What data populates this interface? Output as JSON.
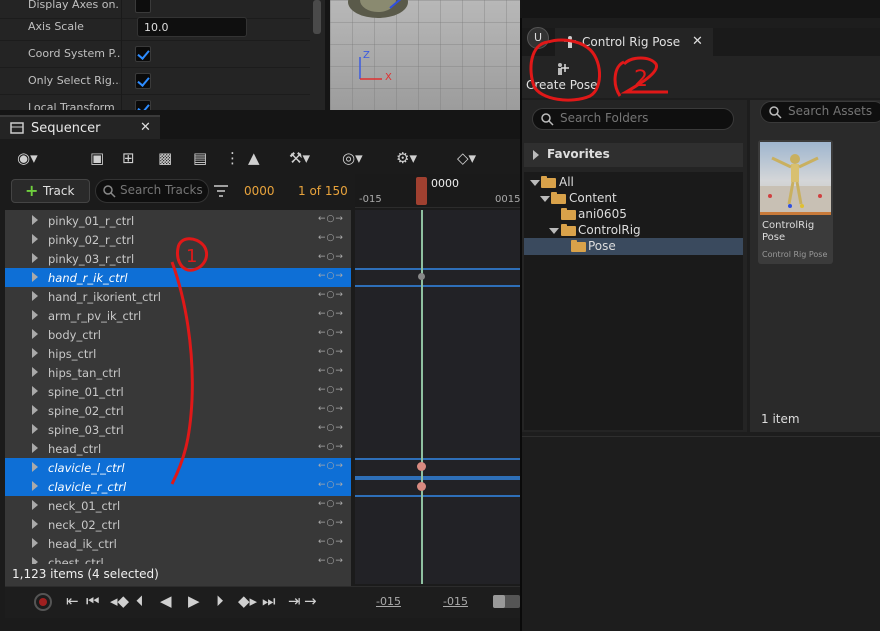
{
  "details": {
    "rows": [
      {
        "label": "Display Axes on...",
        "type": "checkbox",
        "checked": false
      },
      {
        "label": "Axis Scale",
        "type": "number",
        "value": "10.0"
      },
      {
        "label": "Coord System P...",
        "type": "checkbox",
        "checked": true
      },
      {
        "label": "Only Select Rig...",
        "type": "checkbox",
        "checked": true
      },
      {
        "label": "Local Transform",
        "type": "checkbox",
        "checked": true
      }
    ]
  },
  "viewport": {
    "axis_z": "Z",
    "axis_x": "X"
  },
  "sequencer": {
    "tab_title": "Sequencer",
    "add_track_label": "Track",
    "search_placeholder": "Search Tracks",
    "current_frame": "0000",
    "frame_of": "1 of 150",
    "ruler_playhead": "0000",
    "ruler_left": "-015",
    "ruler_right": "0015",
    "tracks": [
      {
        "name": "pinky_01_r_ctrl",
        "selected": false
      },
      {
        "name": "pinky_02_r_ctrl",
        "selected": false
      },
      {
        "name": "pinky_03_r_ctrl",
        "selected": false
      },
      {
        "name": "hand_r_ik_ctrl",
        "selected": true
      },
      {
        "name": "hand_r_ikorient_ctrl",
        "selected": false
      },
      {
        "name": "arm_r_pv_ik_ctrl",
        "selected": false
      },
      {
        "name": "body_ctrl",
        "selected": false
      },
      {
        "name": "hips_ctrl",
        "selected": false
      },
      {
        "name": "hips_tan_ctrl",
        "selected": false
      },
      {
        "name": "spine_01_ctrl",
        "selected": false
      },
      {
        "name": "spine_02_ctrl",
        "selected": false
      },
      {
        "name": "spine_03_ctrl",
        "selected": false
      },
      {
        "name": "head_ctrl",
        "selected": false
      },
      {
        "name": "clavicle_l_ctrl",
        "selected": true
      },
      {
        "name": "clavicle_r_ctrl",
        "selected": true
      },
      {
        "name": "neck_01_ctrl",
        "selected": false
      },
      {
        "name": "neck_02_ctrl",
        "selected": false
      },
      {
        "name": "head_ik_ctrl",
        "selected": false
      },
      {
        "name": "chest_ctrl",
        "selected": false
      }
    ],
    "key_nav": "←○→",
    "status": "1,123 items (4 selected)",
    "play_start": "-015",
    "play_end": "-015"
  },
  "content_browser": {
    "tab_title": "Control Rig Pose",
    "create_pose_label": "Create Pose",
    "folder_search_placeholder": "Search Folders",
    "asset_search_placeholder": "Search Assets",
    "favorites_label": "Favorites",
    "tree": [
      {
        "label": "All",
        "level": 0
      },
      {
        "label": "Content",
        "level": 1
      },
      {
        "label": "ani0605",
        "level": 2
      },
      {
        "label": "ControlRig",
        "level": 2
      },
      {
        "label": "Pose",
        "level": 3
      }
    ],
    "asset": {
      "name": "ControlRig Pose",
      "type": "Control Rig Pose"
    },
    "item_count": "1 item"
  },
  "annotations": {
    "mark_1": "1",
    "mark_2": "2"
  },
  "colors": {
    "selection": "#0e6fd6",
    "accent_orange": "#e8a33c",
    "annotation_red": "#e01818",
    "folder": "#d9a24a"
  }
}
